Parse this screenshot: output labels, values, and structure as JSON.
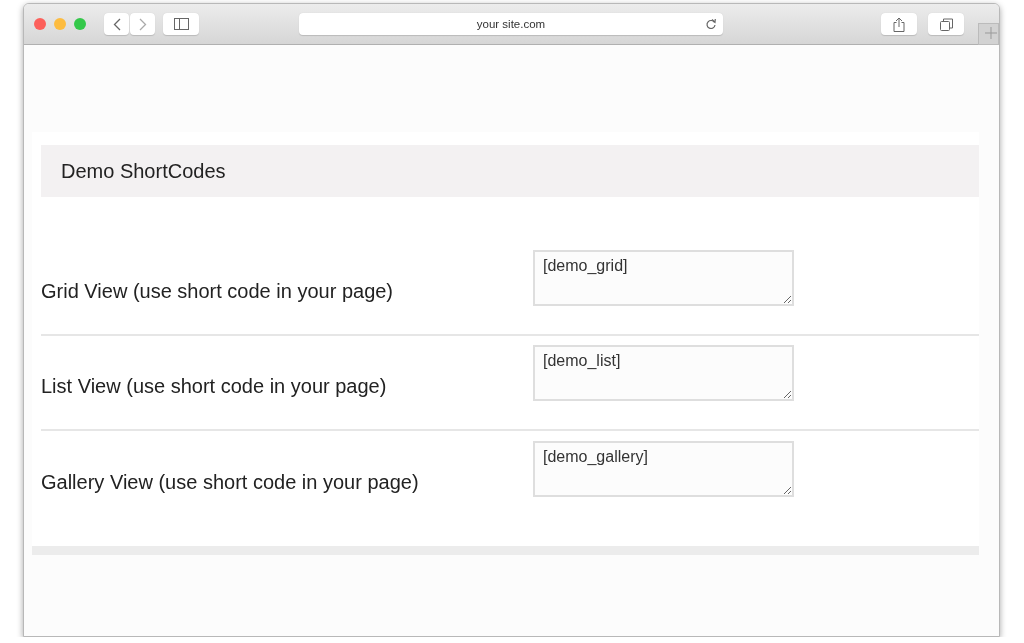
{
  "browser": {
    "address": "your site.com"
  },
  "panel": {
    "title": "Demo ShortCodes",
    "rows": [
      {
        "label": "Grid View (use short code in your page)",
        "value": "[demo_grid]"
      },
      {
        "label": "List View (use short code in your page)",
        "value": "[demo_list]"
      },
      {
        "label": "Gallery View (use short code in your page)",
        "value": "[demo_gallery]"
      }
    ]
  }
}
